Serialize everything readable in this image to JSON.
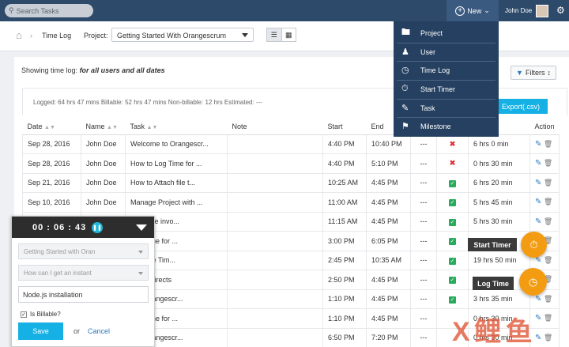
{
  "search": {
    "placeholder": "Search Tasks"
  },
  "header": {
    "new_label": "New",
    "user_name": "John Doe"
  },
  "breadcrumb": {
    "section": "Time Log",
    "project_label": "Project:",
    "project_value": "Getting Started With Orangescrum"
  },
  "new_menu": {
    "items": [
      {
        "label": "Project",
        "icon": "folder-icon"
      },
      {
        "label": "User",
        "icon": "users-icon"
      },
      {
        "label": "Time Log",
        "icon": "clock-icon"
      },
      {
        "label": "Start Timer",
        "icon": "stopwatch-icon"
      },
      {
        "label": "Task",
        "icon": "task-icon"
      },
      {
        "label": "Milestone",
        "icon": "milestone-icon"
      }
    ]
  },
  "page": {
    "showing_prefix": "Showing time log:",
    "showing_scope": "for all users and all dates",
    "filters_label": "Filters"
  },
  "summary": {
    "text": "Logged: 64 hrs 47 mins  Billable: 52 hrs 47 mins  Non-billable: 12 hrs  Estimated: ---",
    "export_label": "Export(.csv)"
  },
  "table": {
    "headers": [
      "Date",
      "Name",
      "Task",
      "Note",
      "Start",
      "End",
      "",
      "",
      "",
      "Action"
    ],
    "rows": [
      {
        "date": "Sep 28, 2016",
        "name": "John Doe",
        "task": "Welcome to Orangescr...",
        "note": "",
        "start": "4:40 PM",
        "end": "10:40 PM",
        "dash": "---",
        "billable": "no",
        "hours": "6 hrs 0 min"
      },
      {
        "date": "Sep 28, 2016",
        "name": "John Doe",
        "task": "How to Log Time for ...",
        "note": "",
        "start": "4:40 PM",
        "end": "5:10 PM",
        "dash": "---",
        "billable": "no",
        "hours": "0 hrs 30 min"
      },
      {
        "date": "Sep 21, 2016",
        "name": "John Doe",
        "task": "How to Attach file t...",
        "note": "",
        "start": "10:25 AM",
        "end": "4:45 PM",
        "dash": "---",
        "billable": "yes",
        "hours": "6 hrs 20 min"
      },
      {
        "date": "Sep 10, 2016",
        "name": "John Doe",
        "task": "Manage Project with ...",
        "note": "",
        "start": "11:00 AM",
        "end": "4:45 PM",
        "dash": "---",
        "billable": "yes",
        "hours": "5 hrs 45 min"
      },
      {
        "date": "",
        "name": "",
        "task": "generate invo...",
        "note": "",
        "start": "11:15 AM",
        "end": "4:45 PM",
        "dash": "---",
        "billable": "yes",
        "hours": "5 hrs 30 min"
      },
      {
        "date": "",
        "name": "",
        "task": "Log Time for ...",
        "note": "",
        "start": "3:00 PM",
        "end": "6:05 PM",
        "dash": "---",
        "billable": "yes",
        "hours": ""
      },
      {
        "date": "",
        "name": "",
        "task": "start the Tim...",
        "note": "",
        "start": "2:45 PM",
        "end": "10:35 AM",
        "dash": "---",
        "billable": "yes",
        "hours": "19 hrs 50 min"
      },
      {
        "date": "",
        "name": "",
        "task": "and redirects",
        "note": "",
        "start": "2:50 PM",
        "end": "4:45 PM",
        "dash": "---",
        "billable": "yes",
        "hours": ""
      },
      {
        "date": "",
        "name": "",
        "task": "e to Orangescr...",
        "note": "",
        "start": "1:10 PM",
        "end": "4:45 PM",
        "dash": "---",
        "billable": "yes",
        "hours": "3 hrs 35 min"
      },
      {
        "date": "",
        "name": "",
        "task": "Log Time for ...",
        "note": "",
        "start": "1:10 PM",
        "end": "4:45 PM",
        "dash": "---",
        "billable": "",
        "hours": "0 hrs 30 min"
      },
      {
        "date": "",
        "name": "",
        "task": "e to Orangescr...",
        "note": "",
        "start": "6:50 PM",
        "end": "7:20 PM",
        "dash": "---",
        "billable": "",
        "hours": "0 hrs 30 min"
      }
    ]
  },
  "timer": {
    "time": "00 : 06 : 43",
    "project_placeholder": "Getting Started with Oran",
    "task_placeholder": "How can I get an instant",
    "description": "Node.js installation",
    "billable_label": "Is Billable?",
    "save_label": "Save",
    "or_label": "or",
    "cancel_label": "Cancel"
  },
  "fabs": {
    "start_timer_label": "Start Timer",
    "log_time_label": "Log Time"
  },
  "colors": {
    "topbar": "#2d4a6b",
    "menu": "#254060",
    "accent": "#15b1e5",
    "fab": "#f39c12"
  }
}
